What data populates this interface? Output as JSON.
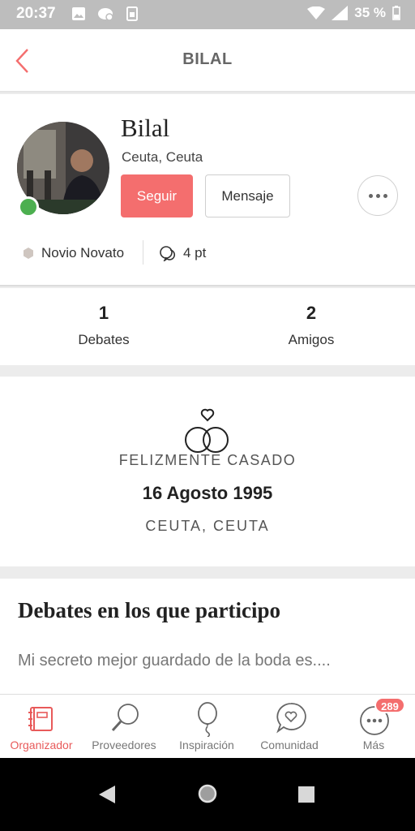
{
  "status_bar": {
    "time": "20:37",
    "battery": "35 %"
  },
  "header": {
    "title": "BILAL"
  },
  "profile": {
    "name": "Bilal",
    "location": "Ceuta, Ceuta",
    "follow_label": "Seguir",
    "message_label": "Mensaje",
    "level": "Novio Novato",
    "points": "4 pt"
  },
  "stats": [
    {
      "value": "1",
      "label": "Debates"
    },
    {
      "value": "2",
      "label": "Amigos"
    }
  ],
  "wedding": {
    "status": "FELIZMENTE CASADO",
    "date": "16 Agosto 1995",
    "place": "CEUTA, CEUTA"
  },
  "debates": {
    "title": "Debates en los que participo",
    "items": [
      "Mi secreto mejor guardado de la boda es...."
    ]
  },
  "bottom_nav": [
    {
      "label": "Organizador",
      "icon": "planner-icon",
      "active": true
    },
    {
      "label": "Proveedores",
      "icon": "search-icon"
    },
    {
      "label": "Inspiración",
      "icon": "balloon-icon"
    },
    {
      "label": "Comunidad",
      "icon": "chat-heart-icon"
    },
    {
      "label": "Más",
      "icon": "more-icon",
      "badge": "289"
    }
  ],
  "colors": {
    "accent": "#f46e6e",
    "online": "#4caf50",
    "status_bar": "#bdbdbd"
  }
}
